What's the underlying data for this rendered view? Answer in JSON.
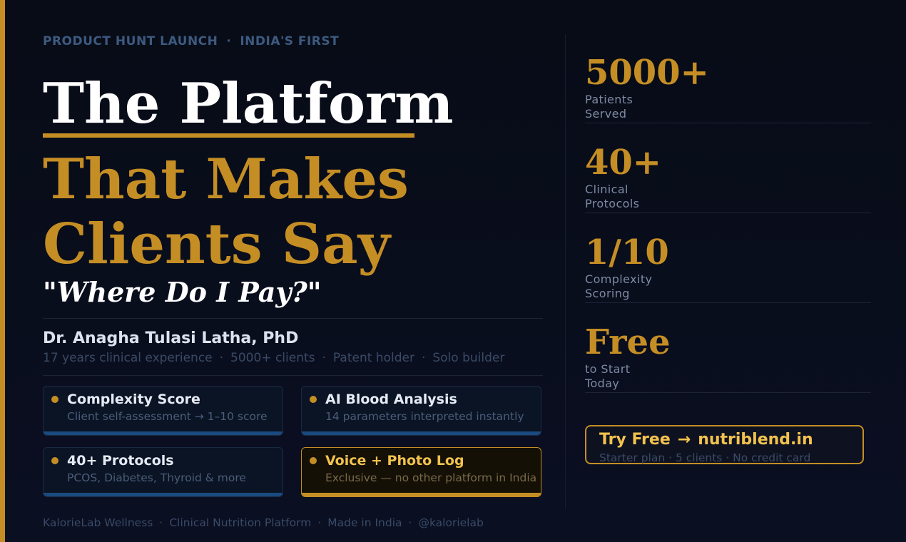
{
  "eyebrow": {
    "part1": "PRODUCT HUNT LAUNCH",
    "separator": "·",
    "part2": "INDIA'S FIRST"
  },
  "headline": {
    "line1": "The Platform",
    "line2": "That Makes",
    "line3": "Clients Say",
    "quote": "\"Where Do I Pay?\""
  },
  "author": {
    "name": "Dr. Anagha Tulasi Latha, PhD",
    "meta": [
      "17 years clinical experience",
      "5000+ clients",
      "Patent holder",
      "Solo builder"
    ],
    "separator": "·"
  },
  "features": [
    {
      "title": "Complexity Score",
      "subtitle": "Client self-assessment → 1–10 score"
    },
    {
      "title": "AI Blood Analysis",
      "subtitle": "14 parameters interpreted instantly"
    },
    {
      "title": "40+ Protocols",
      "subtitle": "PCOS, Diabetes, Thyroid & more"
    },
    {
      "title": "Voice + Photo Log",
      "subtitle": "Exclusive — no other platform in India"
    }
  ],
  "footer": {
    "items": [
      "KalorieLab Wellness",
      "Clinical Nutrition Platform",
      "Made in India",
      "@kalorielab"
    ],
    "separator": "·"
  },
  "stats": [
    {
      "value": "5000+",
      "label_line1": "Patients",
      "label_line2": "Served"
    },
    {
      "value": "40+",
      "label_line1": "Clinical",
      "label_line2": "Protocols"
    },
    {
      "value": "1/10",
      "label_line1": "Complexity",
      "label_line2": "Scoring"
    },
    {
      "value": "Free",
      "label_line1": "to Start",
      "label_line2": "Today"
    }
  ],
  "cta": {
    "label": "Try Free",
    "arrow": "→",
    "url": "nutriblend.in",
    "subtitle": "Starter plan · 5 clients · No credit card"
  },
  "colors": {
    "accent_gold": "#c58e25",
    "highlight_gold": "#f2c24e",
    "background": "#080c16",
    "card_bar_blue": "#1a4b80"
  }
}
